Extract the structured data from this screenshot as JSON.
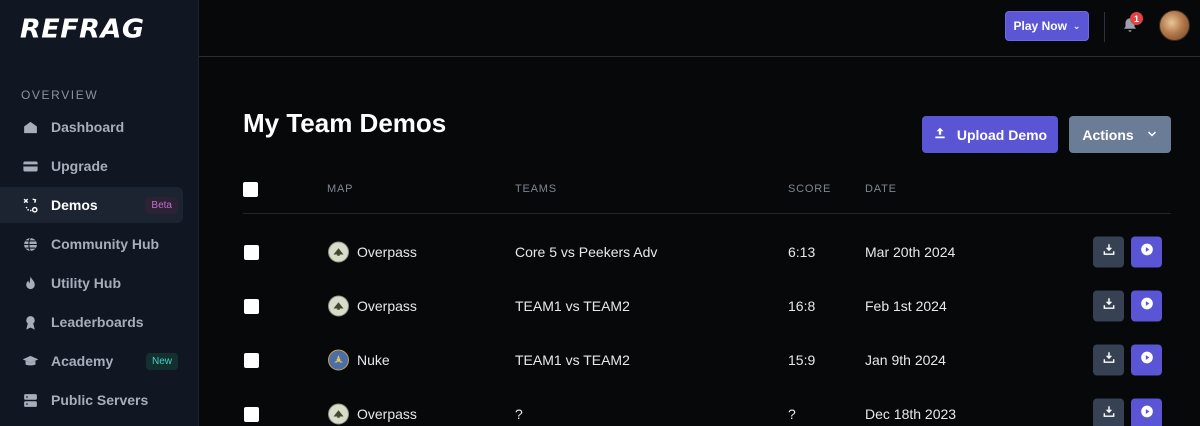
{
  "brand": {
    "logo": "REFRAG"
  },
  "sidebar": {
    "section": "OVERVIEW",
    "items": [
      {
        "label": "Dashboard",
        "icon": "home-icon"
      },
      {
        "label": "Upgrade",
        "icon": "card-icon"
      },
      {
        "label": "Demos",
        "icon": "tactics-icon",
        "badge": "Beta",
        "active": true
      },
      {
        "label": "Community Hub",
        "icon": "globe-icon"
      },
      {
        "label": "Utility Hub",
        "icon": "fire-icon"
      },
      {
        "label": "Leaderboards",
        "icon": "award-icon"
      },
      {
        "label": "Academy",
        "icon": "graduation-cap-icon",
        "badge": "New"
      },
      {
        "label": "Public Servers",
        "icon": "server-icon"
      }
    ]
  },
  "topbar": {
    "play_now": "Play Now",
    "notification_count": "1"
  },
  "page": {
    "title": "My Team Demos",
    "upload_label": "Upload Demo",
    "actions_label": "Actions"
  },
  "table": {
    "columns": [
      "MAP",
      "TEAMS",
      "SCORE",
      "DATE"
    ],
    "rows": [
      {
        "map": "Overpass",
        "teams": "Core 5 vs Peekers Adv",
        "score": "6:13",
        "date": "Mar 20th 2024"
      },
      {
        "map": "Overpass",
        "teams": "TEAM1 vs TEAM2",
        "score": "16:8",
        "date": "Feb 1st 2024"
      },
      {
        "map": "Nuke",
        "teams": "TEAM1 vs TEAM2",
        "score": "15:9",
        "date": "Jan 9th 2024"
      },
      {
        "map": "Overpass",
        "teams": "?",
        "score": "?",
        "date": "Dec 18th 2023"
      }
    ]
  },
  "colors": {
    "accent": "#5a55d4",
    "sidebar_bg": "#111722",
    "page_bg": "#07080a",
    "secondary_button": "#6b7c96"
  }
}
